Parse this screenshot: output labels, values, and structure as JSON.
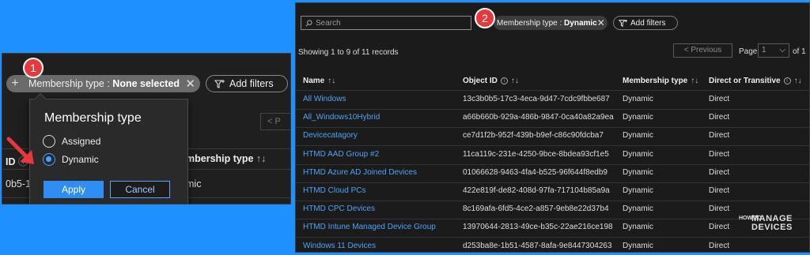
{
  "left": {
    "badge": "1",
    "filter_pill": {
      "prefix": "Membership type : ",
      "value": "None selected"
    },
    "add_filters": "Add filters",
    "prev_button": "< P",
    "headers": {
      "id": "ID",
      "membership": "mbership type"
    },
    "row1": {
      "id": "0b5-17",
      "membership": "mic"
    },
    "popup": {
      "title": "Membership type",
      "options": [
        "Assigned",
        "Dynamic"
      ],
      "selected": "Dynamic",
      "apply": "Apply",
      "cancel": "Cancel"
    }
  },
  "right": {
    "badge": "2",
    "search_placeholder": "Search",
    "filter_pill": {
      "prefix": "Membership type : ",
      "value": "Dynamic"
    },
    "add_filters": "Add filters",
    "showing": "Showing 1 to 9 of 11 records",
    "prev_button": "< Previous",
    "page_label": "Page",
    "page_value": "1",
    "page_of": "of 1",
    "columns": [
      "Name",
      "Object ID",
      "Membership type",
      "Direct or Transitive"
    ],
    "rows": [
      {
        "name": "All Windows",
        "object_id": "13c3b0b5-17c3-4eca-9d47-7cdc9fbbe687",
        "membership": "Dynamic",
        "direct": "Direct"
      },
      {
        "name": "All_Windows10Hybrid",
        "object_id": "a66b660b-929a-486b-9847-0ca40a82a9ea",
        "membership": "Dynamic",
        "direct": "Direct"
      },
      {
        "name": "Devicecatagory",
        "object_id": "ce7d1f2b-952f-439b-b9ef-c86c90fdcba7",
        "membership": "Dynamic",
        "direct": "Direct"
      },
      {
        "name": "HTMD AAD Group #2",
        "object_id": "11ca119c-231e-4250-9bce-8bdea93cf1e5",
        "membership": "Dynamic",
        "direct": "Direct"
      },
      {
        "name": "HTMD Azure AD Joined Devices",
        "object_id": "01066628-9463-4fa4-b525-96f644f8edb9",
        "membership": "Dynamic",
        "direct": "Direct"
      },
      {
        "name": "HTMD Cloud PCs",
        "object_id": "422e819f-de82-408d-97fa-717104b85a9a",
        "membership": "Dynamic",
        "direct": "Direct"
      },
      {
        "name": "HTMD CPC Devices",
        "object_id": "8c169afa-6fd5-4ce2-a857-9eb8e22d37b4",
        "membership": "Dynamic",
        "direct": "Direct"
      },
      {
        "name": "HTMD Intune Managed Device Group",
        "object_id": "13970644-2813-49ce-b35c-22ae216ce198",
        "membership": "Dynamic",
        "direct": "Direct"
      },
      {
        "name": "Windows 11 Devices",
        "object_id": "d253ba8e-1b51-4587-8afa-9e8447304263",
        "membership": "Dynamic",
        "direct": "Direct"
      }
    ],
    "logo": {
      "small": "HOW TO",
      "line1": "MANAGE",
      "line2": "DEVICES"
    }
  },
  "colors": {
    "background": "#1e90ff",
    "link": "#4ea3f7",
    "badge": "#e8383d",
    "accent": "#2f8ef4",
    "arrow": "#e8383d"
  }
}
